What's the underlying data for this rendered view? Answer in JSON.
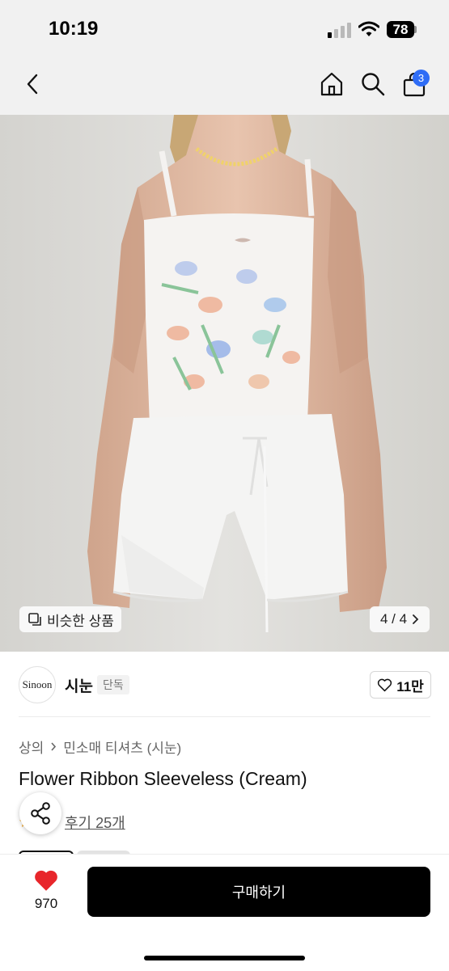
{
  "status_bar": {
    "time": "10:19",
    "battery": "78"
  },
  "nav": {
    "cart_count": "3"
  },
  "image": {
    "similar_label": "비슷한 상품",
    "page_indicator": "4 / 4",
    "current_page": 4,
    "total_pages": 4
  },
  "seller": {
    "logo_text": "Sinoon",
    "name": "시눈",
    "tag": "단독",
    "likes": "11만"
  },
  "breadcrumb": {
    "category": "상의",
    "subcategory": "민소매 티셔츠 (시눈)"
  },
  "product": {
    "title": "Flower Ribbon Sleeveless (Cream)",
    "reviews": "후기 25개"
  },
  "bottom": {
    "heart_count": "970",
    "buy_label": "구매하기"
  },
  "colors": {
    "accent_badge": "#2f6df6",
    "heart": "#e8262b",
    "buy_button": "#000000"
  }
}
